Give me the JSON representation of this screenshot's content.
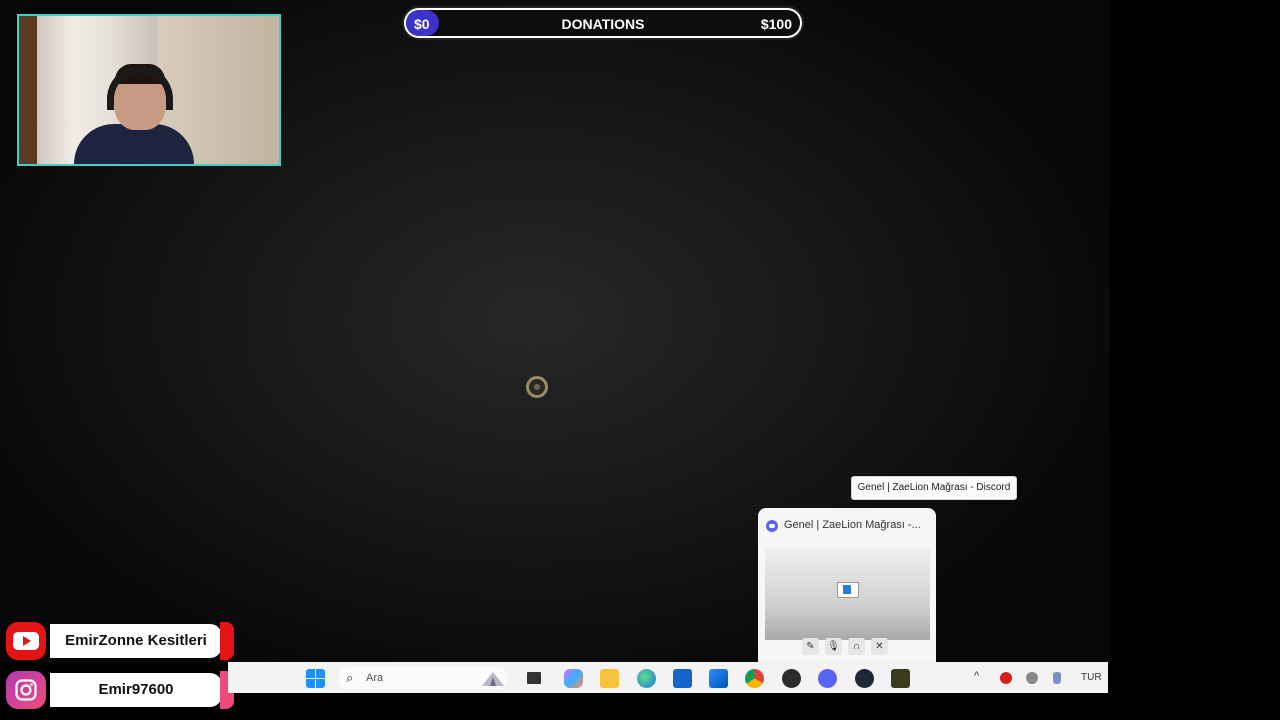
{
  "donations": {
    "current": "$0",
    "title": "DONATIONS",
    "goal": "$100",
    "progress_fraction": 0
  },
  "discord": {
    "tooltip": "Genel | ZaeLion Mağrası - Discord",
    "preview_title": "Genel | ZaeLion Mağrası -..."
  },
  "social": {
    "youtube_label": "EmirZonne Kesitleri",
    "instagram_label": "Emir97600"
  },
  "taskbar": {
    "search_placeholder": "Ara",
    "language": "TUR",
    "icons": [
      "windows-start-icon",
      "search-icon",
      "desktop-widget-icon",
      "file-explorer-small-icon",
      "copilot-icon",
      "folder-icon",
      "edge-icon",
      "store-icon",
      "mail-icon",
      "chrome-icon",
      "app-icon",
      "discord-icon",
      "steam-icon",
      "game-icon"
    ]
  },
  "colors": {
    "webcam_border": "#3fd1c6",
    "donation_fill": "#3b32c9",
    "youtube_red": "#e31414",
    "instagram_pink": "#ee4b7a",
    "discord_blurple": "#5865f2"
  }
}
